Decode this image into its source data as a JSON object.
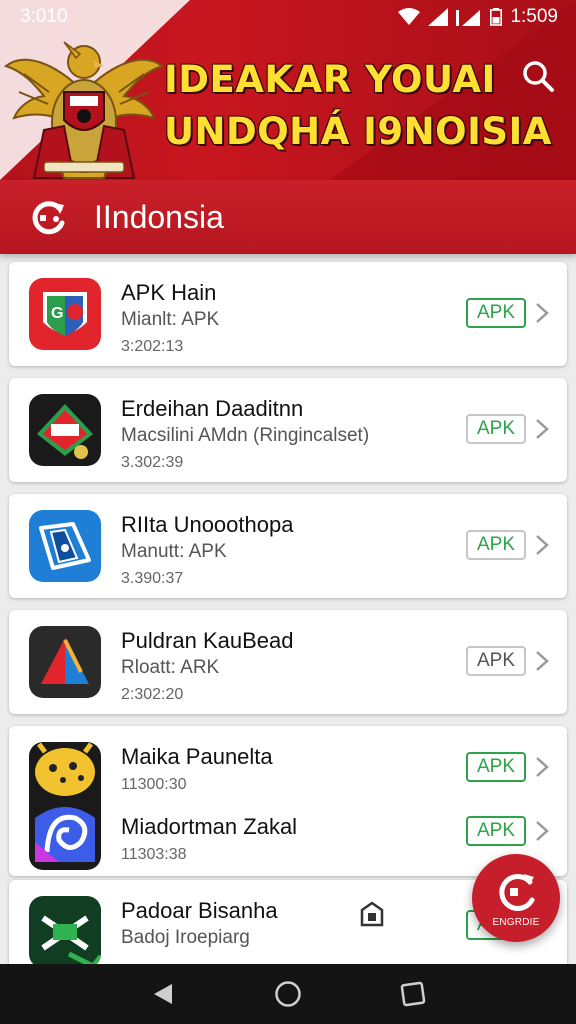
{
  "status_bar": {
    "time": "3:010",
    "clock_right": "1:509"
  },
  "header": {
    "title_line1": "IDEAKAR YOUAI",
    "title_line2": "UNDQHÁ I9NOISIA",
    "colors": {
      "banner": "#c8161f",
      "title": "#ffe032"
    }
  },
  "category": {
    "label": "IIndonsia",
    "icon": "refresh-logo-icon"
  },
  "apps": [
    {
      "title": "APK Hain",
      "subtitle": "Mianlt: APK",
      "date": "3:202:13",
      "button": "APK",
      "icon": "app-red-blue-shield-icon"
    },
    {
      "title": "Erdeihan Daaditnn",
      "subtitle": "Macsilini AMdn (Ringincalset)",
      "date": "3.302:39",
      "button": "APK",
      "icon": "app-dark-green-red-icon"
    },
    {
      "title": "RIIta Unooothopa",
      "subtitle": "Manutt: APK",
      "date": "3.390:37",
      "button": "APK",
      "icon": "app-blue-folder-icon"
    },
    {
      "title": "Puldran KauBead",
      "subtitle": "Rloatt: ARK",
      "date": "2:302:20",
      "button": "APK",
      "icon": "app-dark-red-blue-icon"
    },
    {
      "title": "Maika Paunelta",
      "subtitle": "",
      "date": "11300:30",
      "button": "APK",
      "icon": "app-yellow-character-icon"
    },
    {
      "title": "Miadortman Zakal",
      "subtitle": "",
      "date": "11303:38",
      "button": "APK",
      "icon": "app-purple-swirl-icon"
    },
    {
      "title": "Padoar Bisanha",
      "subtitle": "Badoj Iroepiarg",
      "date": "",
      "button": "APK",
      "icon": "app-dark-green-puzzle-icon"
    }
  ],
  "fab": {
    "label": "ENGRDIE"
  },
  "navigation": {
    "back": "back-icon",
    "home": "home-icon",
    "recents": "recents-icon"
  }
}
